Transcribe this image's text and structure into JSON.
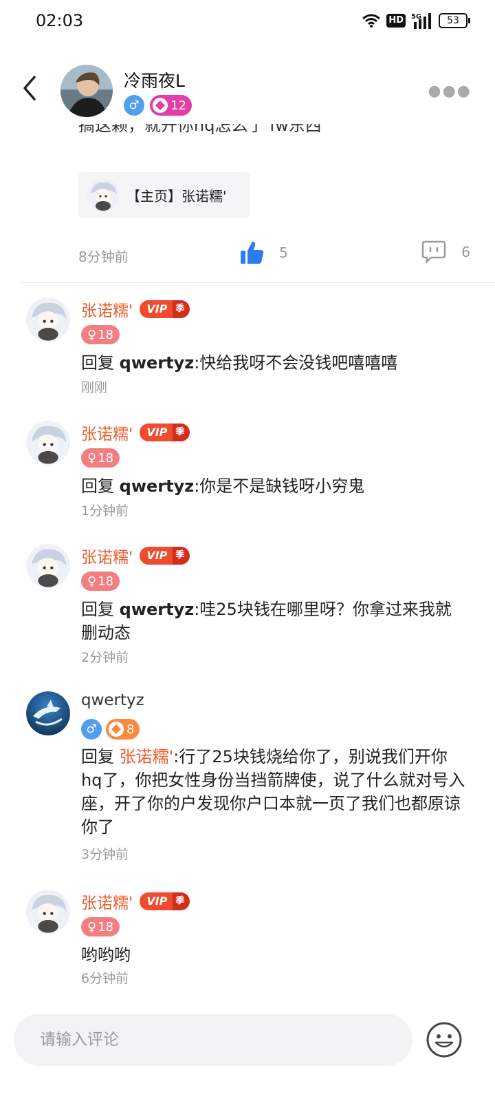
{
  "status": {
    "time": "02:03",
    "network": "5G",
    "hd": "HD",
    "battery": "53"
  },
  "header": {
    "name": "冷雨夜L",
    "level": "12"
  },
  "post": {
    "clipped_text": "搞这颗，就开你hq怎么了 fw东西",
    "link_card_label": "【主页】张诺糯'",
    "time": "8分钟前",
    "likes": "5",
    "comments": "6"
  },
  "comments": [
    {
      "name": "张诺糯'",
      "vip": "VIP",
      "vip_tag": "季",
      "age": "18",
      "prefix": "回复 ",
      "reply_to": "qwertyz",
      "text": ":快给我呀不会没钱吧嘻嘻嘻",
      "time": "刚刚"
    },
    {
      "name": "张诺糯'",
      "vip": "VIP",
      "vip_tag": "季",
      "age": "18",
      "prefix": "回复 ",
      "reply_to": "qwertyz",
      "text": ":你是不是缺钱呀小穷鬼",
      "time": "1分钟前"
    },
    {
      "name": "张诺糯'",
      "vip": "VIP",
      "vip_tag": "季",
      "age": "18",
      "prefix": "回复 ",
      "reply_to": "qwertyz",
      "text": ":哇25块钱在哪里呀？你拿过来我就删动态",
      "time": "2分钟前"
    },
    {
      "name": "qwertyz",
      "level": "8",
      "prefix": "回复 ",
      "reply_to": "张诺糯'",
      "text": ":行了25块钱烧给你了，别说我们开你hq了，你把女性身份当挡箭牌使，说了什么就对号入座，开了你的户发现你户口本就一页了我们也都原谅你了",
      "time": "3分钟前"
    },
    {
      "name": "张诺糯'",
      "vip": "VIP",
      "vip_tag": "季",
      "age": "18",
      "text": "哟哟哟",
      "time": "6分钟前"
    }
  ],
  "input": {
    "placeholder": "请输入评论"
  },
  "colors": {
    "vip_name": "#ef5b2b",
    "male": "#4e9ff0",
    "female": "#f37d80",
    "like_blue": "#2b7cf0"
  },
  "icons": [
    "back-icon",
    "more-icon",
    "like-icon",
    "comment-icon",
    "emoji-icon",
    "wifi-icon",
    "signal-icon",
    "male-icon",
    "female-icon",
    "level-icon"
  ]
}
